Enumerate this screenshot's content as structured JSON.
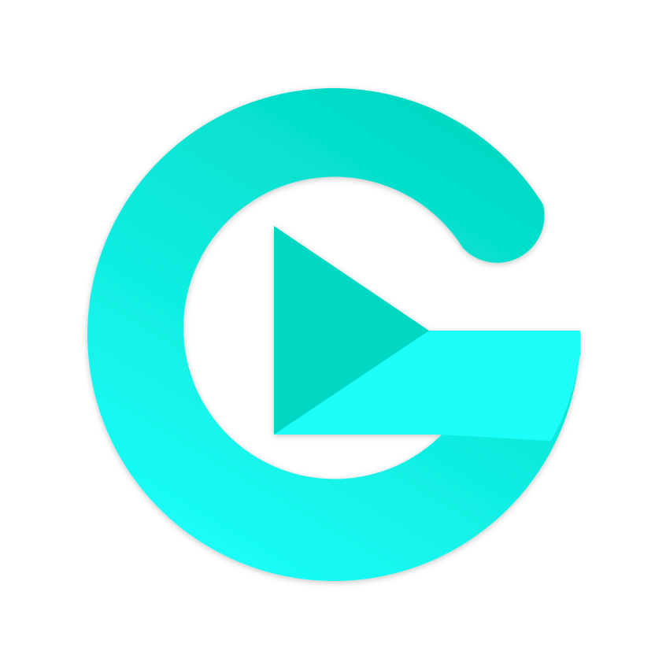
{
  "logo": {
    "icon": "g-play-logo-icon",
    "colors": {
      "ring_gradient_top": "#02d9c4",
      "ring_gradient_bottom": "#1afcf6",
      "bar": "#1dfff8",
      "play_triangle": "#04d8c4",
      "background": "#ffffff"
    }
  }
}
